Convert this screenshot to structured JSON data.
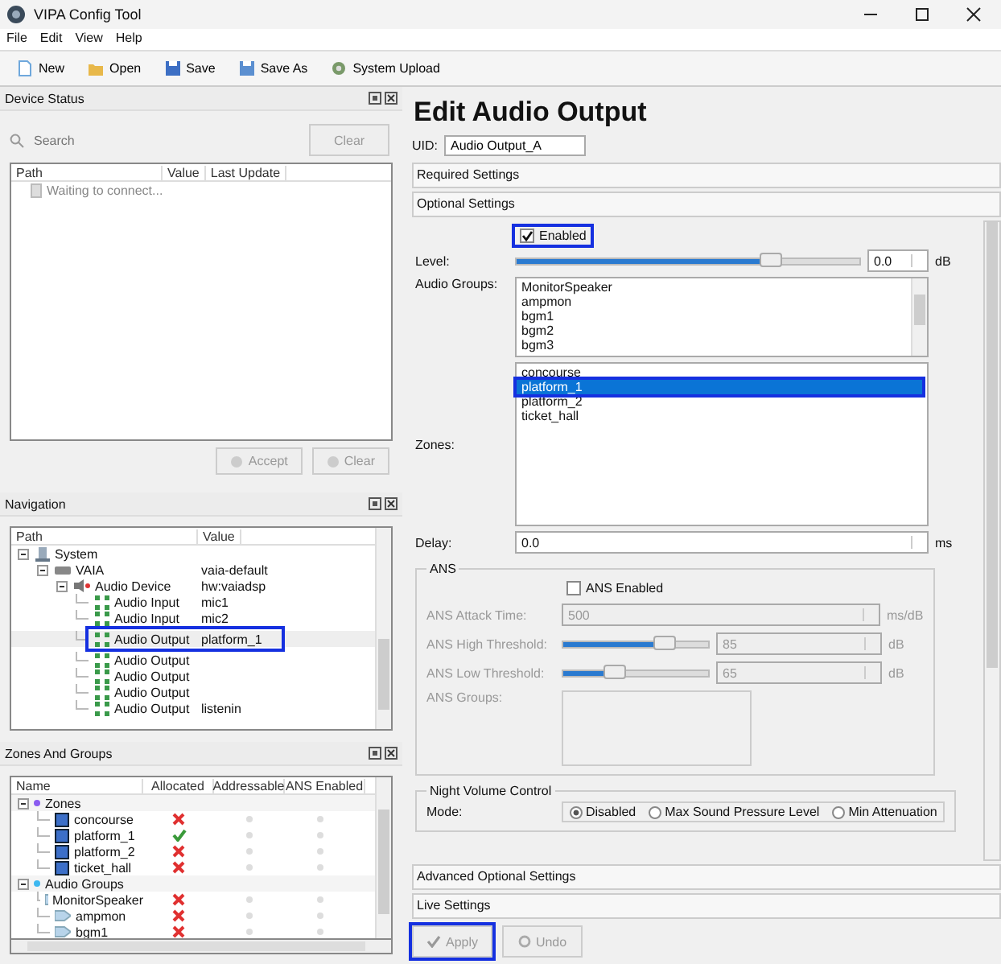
{
  "window": {
    "title": "VIPA Config Tool"
  },
  "menu": [
    "File",
    "Edit",
    "View",
    "Help"
  ],
  "toolbar": [
    {
      "label": "New",
      "kind": "new"
    },
    {
      "label": "Open",
      "kind": "open"
    },
    {
      "label": "Save",
      "kind": "save"
    },
    {
      "label": "Save As",
      "kind": "saveas"
    },
    {
      "label": "System Upload",
      "kind": "upload"
    }
  ],
  "device_status": {
    "title": "Device Status",
    "search": {
      "placeholder": "Search"
    },
    "clear_button": {
      "label": "Clear",
      "disabled": true
    },
    "columns": [
      "Path",
      "Value",
      "Last Update"
    ],
    "rows": [
      {
        "path": "Waiting to connect..."
      }
    ],
    "accept_button": {
      "label": "Accept",
      "disabled": true
    },
    "clear_bottom_button": {
      "label": "Clear",
      "disabled": true
    }
  },
  "navigation": {
    "title": "Navigation",
    "columns": [
      "Path",
      "Value"
    ],
    "tree": [
      {
        "label": "System",
        "kind": "system",
        "expanded": true,
        "children": [
          {
            "label": "VAIA",
            "kind": "device",
            "value": "vaia-default",
            "expanded": true,
            "children": [
              {
                "label": "Audio Device",
                "kind": "audio_device",
                "value": "hw:vaiadsp",
                "expanded": true,
                "children": [
                  {
                    "label": "Audio Input",
                    "kind": "port",
                    "value": "mic1",
                    "selected": false,
                    "highlighted": false
                  },
                  {
                    "label": "Audio Input",
                    "kind": "port",
                    "value": "mic2",
                    "selected": false,
                    "highlighted": false
                  },
                  {
                    "label": "Audio Output",
                    "kind": "port",
                    "value": "platform_1",
                    "selected": true,
                    "highlighted": true
                  },
                  {
                    "label": "Audio Output",
                    "kind": "port",
                    "selected": false,
                    "highlighted": false
                  },
                  {
                    "label": "Audio Output",
                    "kind": "port",
                    "selected": false,
                    "highlighted": false
                  },
                  {
                    "label": "Audio Output",
                    "kind": "port",
                    "selected": false,
                    "highlighted": false
                  },
                  {
                    "label": "Audio Output",
                    "kind": "port",
                    "value": "listenin",
                    "selected": false,
                    "highlighted": false
                  }
                ]
              }
            ]
          }
        ]
      }
    ]
  },
  "zones_and_groups": {
    "title": "Zones And Groups",
    "columns": [
      "Name",
      "Allocated",
      "Addressable",
      "ANS Enabled"
    ],
    "tree": [
      {
        "label": "Zones",
        "kind": "group",
        "color": "#8a5cf0",
        "expanded": true,
        "children": [
          {
            "label": "concourse",
            "kind": "zone",
            "allocated": false
          },
          {
            "label": "platform_1",
            "kind": "zone",
            "allocated": true
          },
          {
            "label": "platform_2",
            "kind": "zone",
            "allocated": false
          },
          {
            "label": "ticket_hall",
            "kind": "zone",
            "allocated": false
          }
        ]
      },
      {
        "label": "Audio Groups",
        "kind": "group",
        "color": "#3db8f0",
        "expanded": true,
        "children": [
          {
            "label": "MonitorSpeaker",
            "kind": "audio_group",
            "allocated": false
          },
          {
            "label": "ampmon",
            "kind": "audio_group",
            "allocated": false
          },
          {
            "label": "bgm1",
            "kind": "audio_group",
            "allocated": false
          }
        ]
      }
    ]
  },
  "editor": {
    "title": "Edit Audio Output",
    "uid_label": "UID:",
    "uid_value": "Audio Output_A",
    "sections": [
      "Required Settings",
      "Optional Settings"
    ],
    "enabled": {
      "label": "Enabled",
      "checked": true,
      "highlighted": true
    },
    "level": {
      "label": "Level:",
      "level": 0.74,
      "value": "0.0",
      "unit": "dB"
    },
    "audio_groups": {
      "label": "Audio Groups:",
      "items": [
        {
          "label": "MonitorSpeaker",
          "selected": false
        },
        {
          "label": "ampmon",
          "selected": false
        },
        {
          "label": "bgm1",
          "selected": false
        },
        {
          "label": "bgm2",
          "selected": false
        },
        {
          "label": "bgm3",
          "selected": false
        }
      ]
    },
    "zones": {
      "label": "Zones:",
      "items": [
        {
          "label": "concourse",
          "selected": false,
          "highlighted": false
        },
        {
          "label": "platform_1",
          "selected": true,
          "highlighted": true
        },
        {
          "label": "platform_2",
          "selected": false,
          "highlighted": false
        },
        {
          "label": "ticket_hall",
          "selected": false,
          "highlighted": false
        }
      ]
    },
    "delay": {
      "label": "Delay:",
      "value": "0.0",
      "unit": "ms"
    },
    "ans": {
      "title": "ANS",
      "enabled": {
        "label": "ANS Enabled",
        "checked": false
      },
      "attack": {
        "label": "ANS Attack Time:",
        "value": "500",
        "unit": "ms/dB",
        "disabled": true
      },
      "high": {
        "label": "ANS High Threshold:",
        "level": 0.7,
        "value": "85",
        "unit": "dB",
        "disabled": true
      },
      "low": {
        "label": "ANS Low Threshold:",
        "level": 0.35,
        "value": "65",
        "unit": "dB",
        "disabled": true
      },
      "groups_label": "ANS Groups:"
    },
    "night": {
      "title": "Night Volume Control",
      "mode_label": "Mode:",
      "options": [
        {
          "label": "Disabled",
          "selected": true
        },
        {
          "label": "Max Sound Pressure Level",
          "selected": false
        },
        {
          "label": "Min Attenuation",
          "selected": false
        }
      ]
    },
    "bottom_sections": [
      "Advanced Optional Settings",
      "Live Settings"
    ],
    "apply_button": {
      "label": "Apply",
      "disabled": true,
      "highlighted": true
    },
    "undo_button": {
      "label": "Undo",
      "disabled": true
    }
  }
}
